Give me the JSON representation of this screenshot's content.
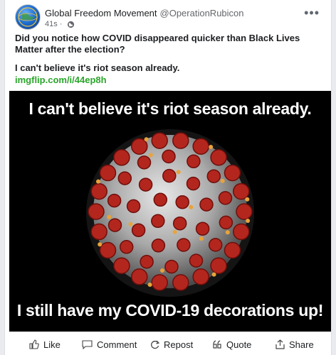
{
  "post": {
    "author_name": "Global Freedom Movement",
    "author_handle": "@OperationRubicon",
    "timestamp": "41s",
    "visibility_icon": "globe-icon",
    "text_line1": "Did you notice how COVID disappeared quicker than Black Lives Matter after the election?",
    "text_line2": "I can't believe it's riot season already.",
    "link": "imgflip.com/i/44ep8h"
  },
  "meme": {
    "top_caption": "I can't believe it's riot season already.",
    "bottom_caption": "I still have my COVID-19 decorations up!",
    "image_subject": "coronavirus-illustration"
  },
  "actions": {
    "like": "Like",
    "comment": "Comment",
    "repost": "Repost",
    "quote": "Quote",
    "share": "Share"
  },
  "colors": {
    "link": "#2aa52a",
    "background": "#e9ebee",
    "card": "#ffffff"
  }
}
